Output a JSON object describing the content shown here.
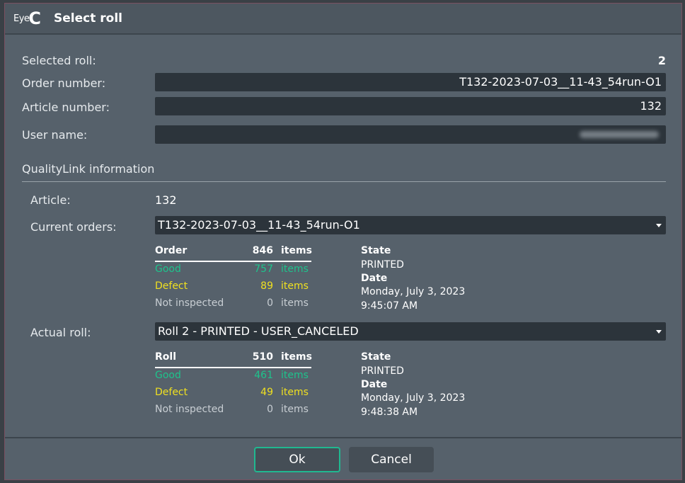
{
  "window": {
    "logo_text": "Eye",
    "logo_mark": "C",
    "title": "Select roll"
  },
  "form": {
    "selected_roll_label": "Selected roll:",
    "selected_roll_value": "2",
    "order_number_label": "Order number:",
    "order_number_value": "T132-2023-07-03__11-43_54run-O1",
    "article_number_label": "Article number:",
    "article_number_value": "132",
    "user_name_label": "User name:",
    "user_name_value": ""
  },
  "qualitylink": {
    "title": "QualityLink information",
    "article_label": "Article:",
    "article_value": "132",
    "current_orders_label": "Current orders:",
    "current_orders_value": "T132-2023-07-03__11-43_54run-O1",
    "order_stats": {
      "header": "Order",
      "header_count": "846",
      "header_unit": "items",
      "good_label": "Good",
      "good_count": "757",
      "good_unit": "items",
      "defect_label": "Defect",
      "defect_count": "89",
      "defect_unit": "items",
      "notinsp_label": "Not inspected",
      "notinsp_count": "0",
      "notinsp_unit": "items",
      "state_label": "State",
      "state_value": "PRINTED",
      "date_label": "Date",
      "date_value": "Monday, July 3, 2023",
      "time_value": "9:45:07 AM"
    },
    "actual_roll_label": "Actual roll:",
    "actual_roll_value": "Roll 2 - PRINTED -  USER_CANCELED",
    "roll_stats": {
      "header": "Roll",
      "header_count": "510",
      "header_unit": "items",
      "good_label": "Good",
      "good_count": "461",
      "good_unit": "items",
      "defect_label": "Defect",
      "defect_count": "49",
      "defect_unit": "items",
      "notinsp_label": "Not inspected",
      "notinsp_count": "0",
      "notinsp_unit": "items",
      "state_label": "State",
      "state_value": "PRINTED",
      "date_label": "Date",
      "date_value": "Monday, July 3, 2023",
      "time_value": "9:48:38 AM"
    }
  },
  "buttons": {
    "ok": "Ok",
    "cancel": "Cancel"
  },
  "colors": {
    "accent": "#20b890",
    "good": "#1ec38c",
    "defect": "#f0e020",
    "background": "#56616b"
  }
}
